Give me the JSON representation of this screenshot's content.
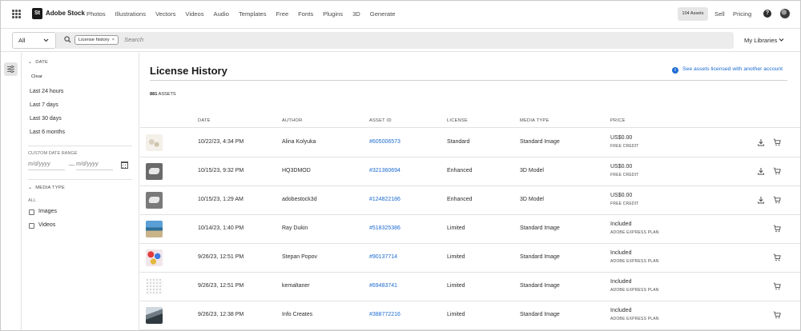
{
  "topbar": {
    "logo_text": "St",
    "brand": "Adobe Stock",
    "nav": [
      "Photos",
      "Illustrations",
      "Vectors",
      "Videos",
      "Audio",
      "Templates",
      "Free",
      "Fonts",
      "Plugins",
      "3D",
      "Generate"
    ],
    "assets_pill": "104 Assets",
    "sell": "Sell",
    "pricing": "Pricing",
    "help": "?"
  },
  "search": {
    "scope": "All",
    "chip": "License history",
    "chip_close": "×",
    "placeholder": "Search",
    "libraries": "My Libraries"
  },
  "sidebar": {
    "date_header": "DATE",
    "clear": "Clear",
    "date_options": [
      "Last 24 hours",
      "Last 7 days",
      "Last 30 days",
      "Last 6 months"
    ],
    "custom_range_label": "CUSTOM DATE RANGE",
    "from_placeholder": "m/d/yyyy",
    "to_placeholder": "m/d/yyyy",
    "range_dash": "—",
    "media_header": "MEDIA TYPE",
    "media_all": "ALL",
    "media_options": [
      "Images",
      "Videos"
    ]
  },
  "main": {
    "title": "License History",
    "info_link": "See assets licensed with another account",
    "count": "881",
    "count_suffix": "ASSETS",
    "columns": [
      "DATE",
      "AUTHOR",
      "ASSET ID",
      "LICENSE",
      "MEDIA TYPE",
      "PRICE"
    ],
    "rows": [
      {
        "date": "10/22/23, 4:34 PM",
        "author": "Alina Kolyuka",
        "asset_id": "#605006573",
        "license": "Standard",
        "media": "Standard Image",
        "price": "US$0.00",
        "price_sub": "FREE CREDIT",
        "thumb": "sketch",
        "download": true
      },
      {
        "date": "10/15/23, 9:32 PM",
        "author": "HQ3DMOD",
        "asset_id": "#321360694",
        "license": "Enhanced",
        "media": "3D Model",
        "price": "US$0.00",
        "price_sub": "FREE CREDIT",
        "thumb": "model-a",
        "download": true
      },
      {
        "date": "10/15/23, 1:29 AM",
        "author": "adobestock3d",
        "asset_id": "#124822186",
        "license": "Enhanced",
        "media": "3D Model",
        "price": "US$0.00",
        "price_sub": "FREE CREDIT",
        "thumb": "model-b",
        "download": true
      },
      {
        "date": "10/14/23, 1:40 PM",
        "author": "Ray Dukin",
        "asset_id": "#518325386",
        "license": "Limited",
        "media": "Standard Image",
        "price": "Included",
        "price_sub": "ADOBE EXPRESS PLAN",
        "thumb": "photo-sea",
        "download": false
      },
      {
        "date": "9/26/23, 12:51 PM",
        "author": "Stepan Popov",
        "asset_id": "#90137714",
        "license": "Limited",
        "media": "Standard Image",
        "price": "Included",
        "price_sub": "ADOBE EXPRESS PLAN",
        "thumb": "pattern-color",
        "download": false
      },
      {
        "date": "9/26/23, 12:51 PM",
        "author": "kemaltaner",
        "asset_id": "#69483741",
        "license": "Limited",
        "media": "Standard Image",
        "price": "Included",
        "price_sub": "ADOBE EXPRESS PLAN",
        "thumb": "dots",
        "download": false
      },
      {
        "date": "9/26/23, 12:38 PM",
        "author": "Info Creates",
        "asset_id": "#388772216",
        "license": "Limited",
        "media": "Standard Image",
        "price": "Included",
        "price_sub": "ADOBE EXPRESS PLAN",
        "thumb": "photo-road",
        "download": false
      }
    ]
  },
  "colors": {
    "link": "#1c6bd0",
    "pill_bg": "#e6e6e6",
    "search_bg": "#ececec"
  }
}
